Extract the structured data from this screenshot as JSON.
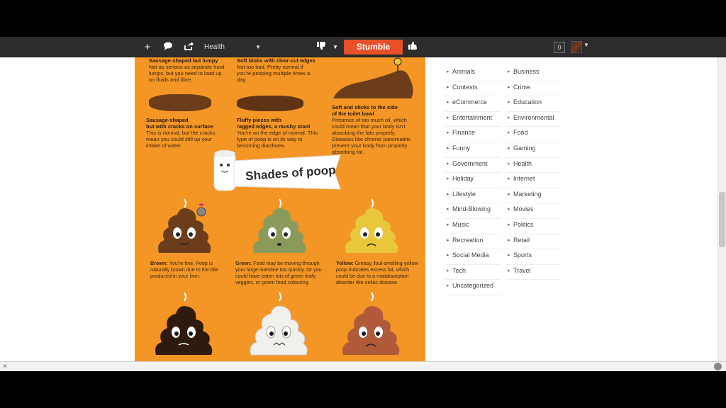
{
  "toolbar": {
    "add_icon": "plus-icon",
    "comment_icon": "speech-bubble-icon",
    "share_icon": "share-icon",
    "topic": "Health",
    "dislike_icon": "thumbs-down-icon",
    "stumble_label": "Stumble",
    "like_icon": "thumbs-up-icon",
    "count": "0",
    "accent": "#e8502a"
  },
  "infographic": {
    "top_items": [
      {
        "title": "Sausage-shaped but lumpy",
        "desc": "Not as serious as separate hard lumps, but you need to load up on fluids and fibre."
      },
      {
        "title": "Soft blobs with clear-cut edges",
        "desc": "Not too bad. Pretty normal if you're pooping multiple times a day."
      },
      {
        "title": "Sausage-shaped\nbut with cracks on surface",
        "desc": "This is normal, but the cracks mean you could still up your intake of water."
      },
      {
        "title": "Fluffy pieces with\nragged edges, a mushy stool",
        "desc": "You're on the edge of normal. This type of poop is on its way to becoming diarrhoea."
      },
      {
        "title": "Soft and sticks to the side\nof the toilet bowl",
        "desc": "Presence of too much oil, which could mean that your body isn't absorbing the fats properly. Diseases like chronic pancreatitis prevent your body from properly absorbing fat."
      }
    ],
    "banner": "Shades of poop",
    "shades": [
      {
        "name": "Brown:",
        "desc": " You're fine. Poop is naturally brown due to the bile produced in your liver.",
        "color": "#6b3d1a"
      },
      {
        "name": "Green:",
        "desc": " Food may be moving through your large intestine too quickly. Or you could have eaten lots of green leafy veggies, or green food colouring.",
        "color": "#8a9a5a"
      },
      {
        "name": "Yellow:",
        "desc": " Greasy, foul-smelling yellow poop indicates excess fat, which could be due to a malabsorption disorder like celiac disease.",
        "color": "#e8c83a"
      }
    ],
    "bottom_colors": [
      "#2e1a0e",
      "#f2f0ea",
      "#b05a3a"
    ]
  },
  "categories": {
    "left": [
      "Animals",
      "Contests",
      "eCommerce",
      "Entertainment",
      "Finance",
      "Funny",
      "Government",
      "Holiday",
      "Lifestyle",
      "Mind-Blowing",
      "Music",
      "Recreation",
      "Social Media",
      "Tech",
      "Uncategorized"
    ],
    "right": [
      "Business",
      "Crime",
      "Education",
      "Environmental",
      "Food",
      "Gaming",
      "Health",
      "Internet",
      "Marketing",
      "Movies",
      "Politics",
      "Retail",
      "Sports",
      "Travel"
    ]
  },
  "status": {
    "close": "×"
  }
}
